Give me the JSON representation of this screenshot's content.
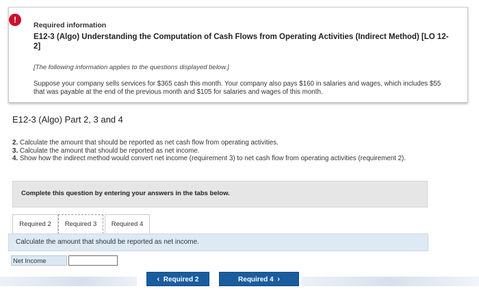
{
  "info": {
    "alert_glyph": "!",
    "heading": "Required information",
    "title": "E12-3 (Algo) Understanding the Computation of Cash Flows from Operating Activities (Indirect Method) [LO 12-2]",
    "note": "[The following information applies to the questions displayed below.]",
    "scenario": "Suppose your company sells services for $365 cash this month. Your company also pays $160 in salaries and wages, which includes $55 that was payable at the end of the previous month and $105 for salaries and wages of this month."
  },
  "part_title": "E12-3 (Algo) Part 2, 3 and 4",
  "questions": [
    {
      "num": "2.",
      "text": "Calculate the amount that should be reported as net cash flow from operating activities."
    },
    {
      "num": "3.",
      "text": "Calculate the amount that should be reported as net income."
    },
    {
      "num": "4.",
      "text": "Show how the indirect method would convert net income (requirement 3) to net cash flow from operating activities (requirement 2)."
    }
  ],
  "complete_prompt": "Complete this question by entering your answers in the tabs below.",
  "tabs": [
    "Required 2",
    "Required 3",
    "Required 4"
  ],
  "active_tab": "Required 3",
  "instruction": "Calculate the amount that should be reported as net income.",
  "net_income": {
    "label": "Net Income",
    "value": ""
  },
  "nav": {
    "prev_label": "Required 2",
    "next_label": "Required 4",
    "prev_icon": "chevron-left-icon",
    "next_icon": "chevron-right-icon"
  },
  "colors": {
    "alert": "#c8102e",
    "nav_button": "#1a5d9f",
    "instruction_bar": "#dde9f3"
  }
}
